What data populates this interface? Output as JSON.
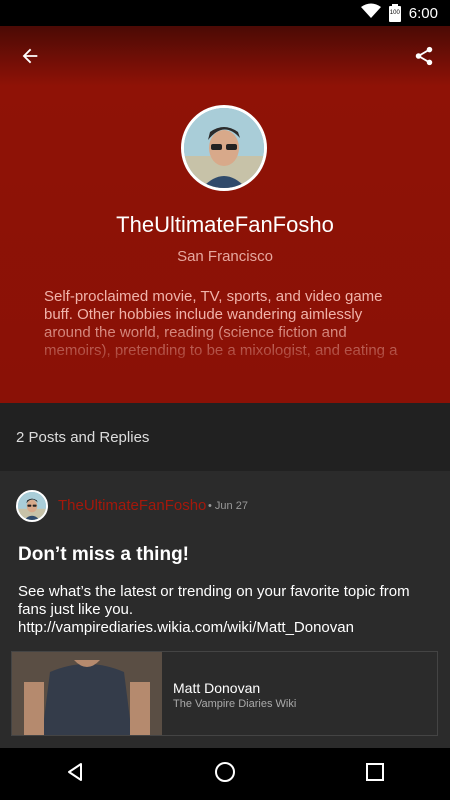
{
  "status_bar": {
    "time": "6:00",
    "battery_label": "100",
    "icons": [
      "wifi-icon",
      "battery-icon"
    ]
  },
  "toolbar": {
    "back_icon": "arrow-left-icon",
    "share_icon": "share-icon"
  },
  "profile": {
    "username": "TheUltimateFanFosho",
    "location": "San Francisco",
    "bio": "Self-proclaimed movie, TV, sports, and video game buff. Other hobbies include wandering aimlessly around the world, reading (science fiction and memoirs), pretending to be a mixologist, and eating a"
  },
  "posts_header": {
    "label": "2 Posts and Replies"
  },
  "post": {
    "author": "TheUltimateFanFosho",
    "date": "• Jun 27",
    "title": "Don’t miss a thing!",
    "body": "See what’s the latest or trending on your favorite topic from fans just like you. http://vampirediaries.wikia.com/wiki/Matt_Donovan",
    "link_card": {
      "title": "Matt Donovan",
      "source": "The Vampire Diaries Wiki"
    }
  },
  "nav_bar": {
    "icons": [
      "back-triangle-icon",
      "home-circle-icon",
      "recents-square-icon"
    ]
  },
  "colors": {
    "hero_red": "#8f1206",
    "author_red": "#a4180b",
    "background": "#2b2b2b",
    "section_header": "#212121"
  }
}
